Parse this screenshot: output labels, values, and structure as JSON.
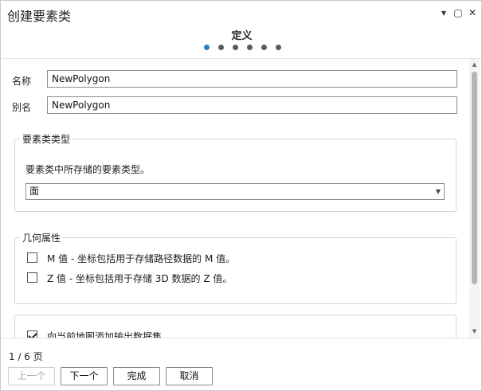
{
  "window": {
    "title": "创建要素类",
    "controls": {
      "dropdown": "▾",
      "maximize": "▢",
      "close": "✕"
    }
  },
  "wizard": {
    "step_title": "定义",
    "step_count": 6,
    "active_step": 1
  },
  "fields": {
    "name": {
      "label": "名称",
      "value": "NewPolygon"
    },
    "alias": {
      "label": "别名",
      "value": "NewPolygon"
    }
  },
  "feature_type_group": {
    "legend": "要素类类型",
    "description": "要素类中所存储的要素类型。",
    "selected": "面"
  },
  "geometry_group": {
    "legend": "几何属性",
    "options": [
      {
        "label": "M 值 - 坐标包括用于存储路径数据的 M 值。",
        "checked": false
      },
      {
        "label": "Z 值 - 坐标包括用于存储 3D 数据的 Z 值。",
        "checked": false
      }
    ]
  },
  "add_to_map": {
    "label": "向当前地图添加输出数据集",
    "checked": true
  },
  "footer": {
    "page_info": "1 / 6 页",
    "buttons": {
      "prev": "上一个",
      "next": "下一个",
      "finish": "完成",
      "cancel": "取消"
    }
  }
}
